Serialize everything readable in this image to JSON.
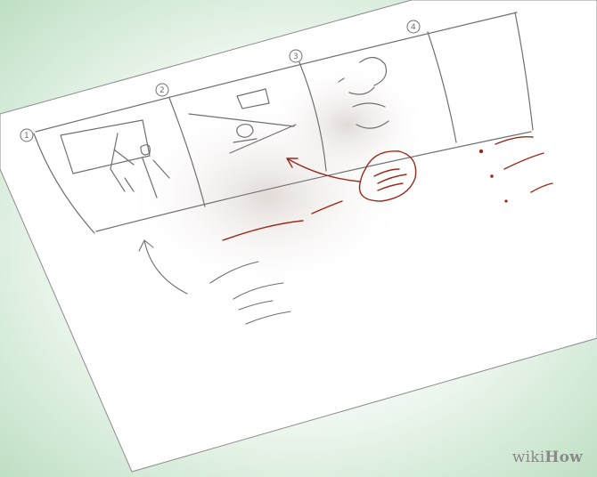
{
  "image": {
    "description_tags": [
      "storyboard-sketch",
      "paper-sheet",
      "red-annotations"
    ],
    "colors": {
      "background_green": "#cfe8d2",
      "paper": "#ffffff",
      "pencil": "#6f6f6f",
      "annotation_red": "#9b2a1a",
      "watermark": "#8a8a8a"
    }
  },
  "storyboard": {
    "frames": [
      {
        "number": "1"
      },
      {
        "number": "2"
      },
      {
        "number": "3"
      },
      {
        "number": "4"
      }
    ]
  },
  "watermark": {
    "part1": "wiki",
    "part2": "How"
  }
}
